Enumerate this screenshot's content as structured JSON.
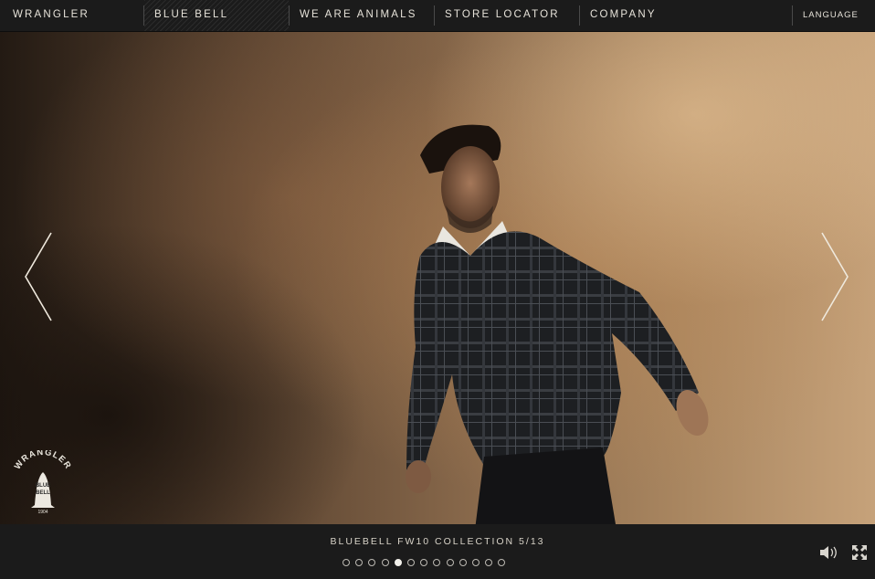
{
  "nav": {
    "items": [
      {
        "label": "WRANGLER"
      },
      {
        "label": "BLUE BELL"
      },
      {
        "label": "WE ARE ANIMALS"
      },
      {
        "label": "STORE LOCATOR"
      },
      {
        "label": "COMPANY"
      }
    ],
    "language": "LANGUAGE"
  },
  "stage": {
    "prev_icon": "chevron-left-icon",
    "next_icon": "chevron-right-icon",
    "logo_icon": "wrangler-blue-bell-logo-icon",
    "logo_text": {
      "arc": "WRANGLER",
      "line1": "BLUE",
      "line2": "BELL",
      "year": "1904"
    }
  },
  "footer": {
    "caption": "BLUEBELL FW10 COLLECTION 5/13",
    "slide_total": 13,
    "slide_current": 5,
    "sound_icon": "speaker-icon",
    "fullscreen_icon": "fullscreen-icon"
  },
  "colors": {
    "bar": "#1b1b1b",
    "text": "#e6e2d9",
    "accent_warm": "#c6a27a"
  }
}
